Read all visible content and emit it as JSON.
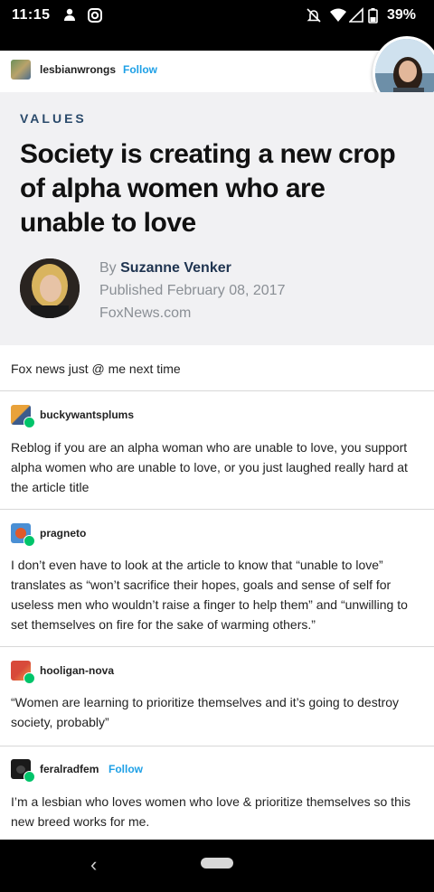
{
  "status_bar": {
    "time": "11:15",
    "battery": "39%",
    "icons": [
      "notification-icon",
      "instagram-icon",
      "mute-icon",
      "wifi-icon",
      "signal-icon",
      "battery-icon"
    ]
  },
  "original_post": {
    "username": "lesbianwrongs",
    "follow_label": "Follow"
  },
  "article": {
    "kicker": "VALUES",
    "headline": "Society is creating a new crop of alpha women who are unable to love",
    "by_prefix": "By",
    "author": "Suzanne Venker",
    "published": "Published February 08, 2017",
    "source": "FoxNews.com"
  },
  "caption": "Fox news just @ me next time",
  "reblogs": [
    {
      "username": "buckywantsplums",
      "text": "Reblog if you are an alpha woman who are unable to love, you support alpha women who are unable to love, or you just laughed really hard at the article title"
    },
    {
      "username": "pragneto",
      "text": "I don’t even have to look at the article to know that “unable to love” translates as “won’t sacrifice their hopes, goals and sense of self for useless men who wouldn’t raise a finger to help them” and “unwilling to set themselves on fire for the sake of warming others.”"
    },
    {
      "username": "hooligan-nova",
      "text": "“Women are learning to prioritize themselves and it’s going to destroy society, probably”"
    },
    {
      "username": "feralradfem",
      "follow_label": "Follow",
      "text": "I’m a lesbian who loves women who love & prioritize themselves so this new breed works for me."
    }
  ],
  "nav": {
    "back_glyph": "‹"
  },
  "colors": {
    "follow": "#1ea0e6",
    "kicker": "#2a4a6b",
    "author": "#1f3450",
    "reblog_badge": "#00c46a"
  }
}
